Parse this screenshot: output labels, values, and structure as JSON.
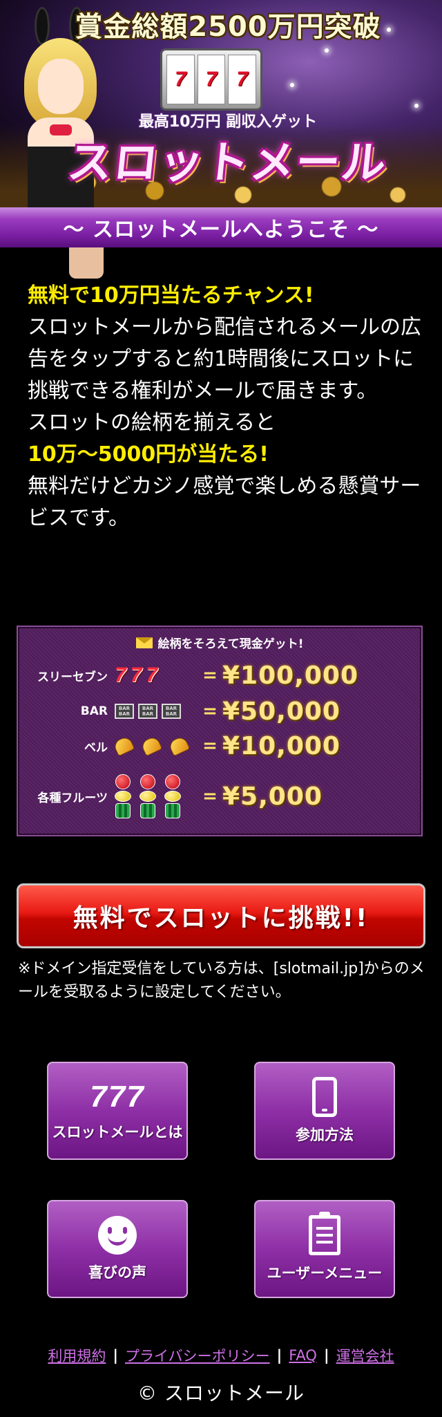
{
  "hero": {
    "title": "賞金総額2500万円突破",
    "slot_reels": [
      "7",
      "7",
      "7"
    ],
    "subtitle": "最高10万円 副収入ゲット",
    "logo": "スロットメール"
  },
  "welcome": "〜 スロットメールへようこそ 〜",
  "intro": {
    "headline": "無料で10万円当たるチャンス!",
    "body1": "スロットメールから配信されるメールの広告をタップすると約1時間後にスロットに挑戦できる権利がメールで届きます。",
    "body2": "スロットの絵柄を揃えると",
    "highlight": "10万〜5000円が当たる!",
    "body3": "無料だけどカジノ感覚で楽しめる懸賞サービスです。"
  },
  "prize_table": {
    "heading": "絵柄をそろえて現金ゲット!",
    "equals": "=",
    "rows": [
      {
        "label": "スリーセブン",
        "symbol": "seven",
        "amount": "¥100,000"
      },
      {
        "label": "BAR",
        "symbol": "bar",
        "symbol_text": "BAR BAR",
        "amount": "¥50,000"
      },
      {
        "label": "ベル",
        "symbol": "bell",
        "amount": "¥10,000"
      },
      {
        "label": "各種フルーツ",
        "symbol": "fruits",
        "amount": "¥5,000"
      }
    ]
  },
  "cta": {
    "label": "無料でスロットに挑戦!!",
    "note": "※ドメイン指定受信をしている方は、[slotmail.jp]からのメールを受取るように設定してください。"
  },
  "tiles": [
    {
      "label": "スロットメールとは",
      "icon": "777",
      "icon_text": "777"
    },
    {
      "label": "参加方法",
      "icon": "smartphone-icon"
    },
    {
      "label": "喜びの声",
      "icon": "smile-icon"
    },
    {
      "label": "ユーザーメニュー",
      "icon": "clipboard-icon"
    }
  ],
  "footer": {
    "links": [
      "利用規約",
      "プライバシーポリシー",
      "FAQ",
      "運営会社"
    ],
    "separator": "|",
    "copyright": "© スロットメール"
  },
  "colors": {
    "accent_yellow": "#ffee00",
    "welcome_purple": "#7a1fa2",
    "cta_red": "#e81a14",
    "tile_purple": "#8e2fa6",
    "link_pink": "#d070e8"
  }
}
